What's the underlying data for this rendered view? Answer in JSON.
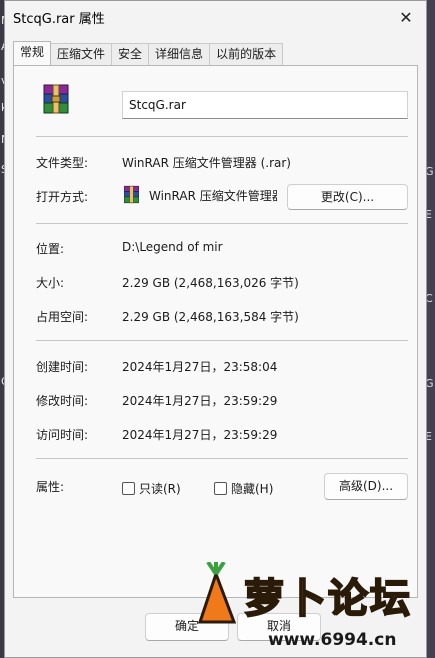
{
  "window": {
    "title": "StcqG.rar 属性",
    "close_glyph": "✕"
  },
  "tabs": [
    {
      "label": "常规",
      "active": true
    },
    {
      "label": "压缩文件",
      "active": false
    },
    {
      "label": "安全",
      "active": false
    },
    {
      "label": "详细信息",
      "active": false
    },
    {
      "label": "以前的版本",
      "active": false
    }
  ],
  "general": {
    "file_name": "StcqG.rar",
    "file_type_label": "文件类型:",
    "file_type_value": "WinRAR 压缩文件管理器 (.rar)",
    "open_with_label": "打开方式:",
    "open_with_value": "WinRAR 压缩文件管理器",
    "change_button": "更改(C)...",
    "location_label": "位置:",
    "location_value": "D:\\Legend of mir",
    "size_label": "大小:",
    "size_value": "2.29 GB (2,468,163,026 字节)",
    "size_on_disk_label": "占用空间:",
    "size_on_disk_value": "2.29 GB (2,468,163,584 字节)",
    "created_label": "创建时间:",
    "created_value": "2024年1月27日，23:58:04",
    "modified_label": "修改时间:",
    "modified_value": "2024年1月27日，23:59:29",
    "accessed_label": "访问时间:",
    "accessed_value": "2024年1月27日，23:59:29",
    "attributes_label": "属性:",
    "readonly_label": "只读(R)",
    "readonly_checked": false,
    "hidden_label": "隐藏(H)",
    "hidden_checked": false,
    "advanced_button": "高级(D)..."
  },
  "footer": {
    "ok_button": "确定",
    "cancel_button": "取消"
  },
  "watermark": {
    "text": "萝卜论坛",
    "url": "www.6994.cn"
  },
  "background": {
    "left_letters": [
      "M",
      "A",
      "va",
      "kn",
      "N",
      "St",
      "G"
    ],
    "right_letters": [
      "G",
      "E",
      "C",
      "G",
      "E"
    ]
  },
  "colors": {
    "accent": "#0067c0",
    "winrar_red": "#b3262b",
    "winrar_blue": "#2a4fa0",
    "winrar_green": "#2f8f3a"
  }
}
